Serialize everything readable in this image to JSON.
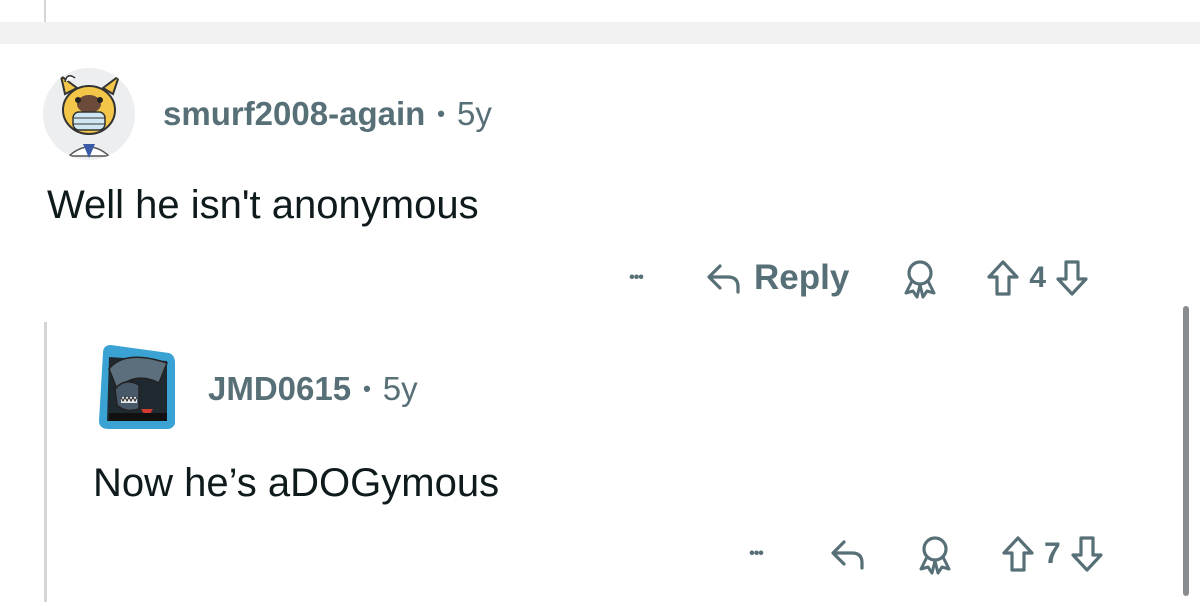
{
  "comments": [
    {
      "username": "smurf2008-again",
      "separator": "•",
      "age": "5y",
      "body": "Well he isn't anonymous",
      "actions": {
        "more": "•••",
        "reply_label": "Reply",
        "vote_count": "4"
      }
    },
    {
      "username": "JMD0615",
      "separator": "•",
      "age": "5y",
      "body": "Now he’s aDOGymous",
      "actions": {
        "more": "•••",
        "vote_count": "7"
      }
    }
  ],
  "icons": {
    "more": "more-options-icon",
    "reply": "reply-arrow-icon",
    "award": "award-icon",
    "upvote": "upvote-arrow-icon",
    "downvote": "downvote-arrow-icon"
  },
  "colors": {
    "meta_text": "#576f76",
    "body_text": "#0f1a1c",
    "separator_band": "#f2f2f3",
    "thread_line": "#d4d6d8"
  }
}
